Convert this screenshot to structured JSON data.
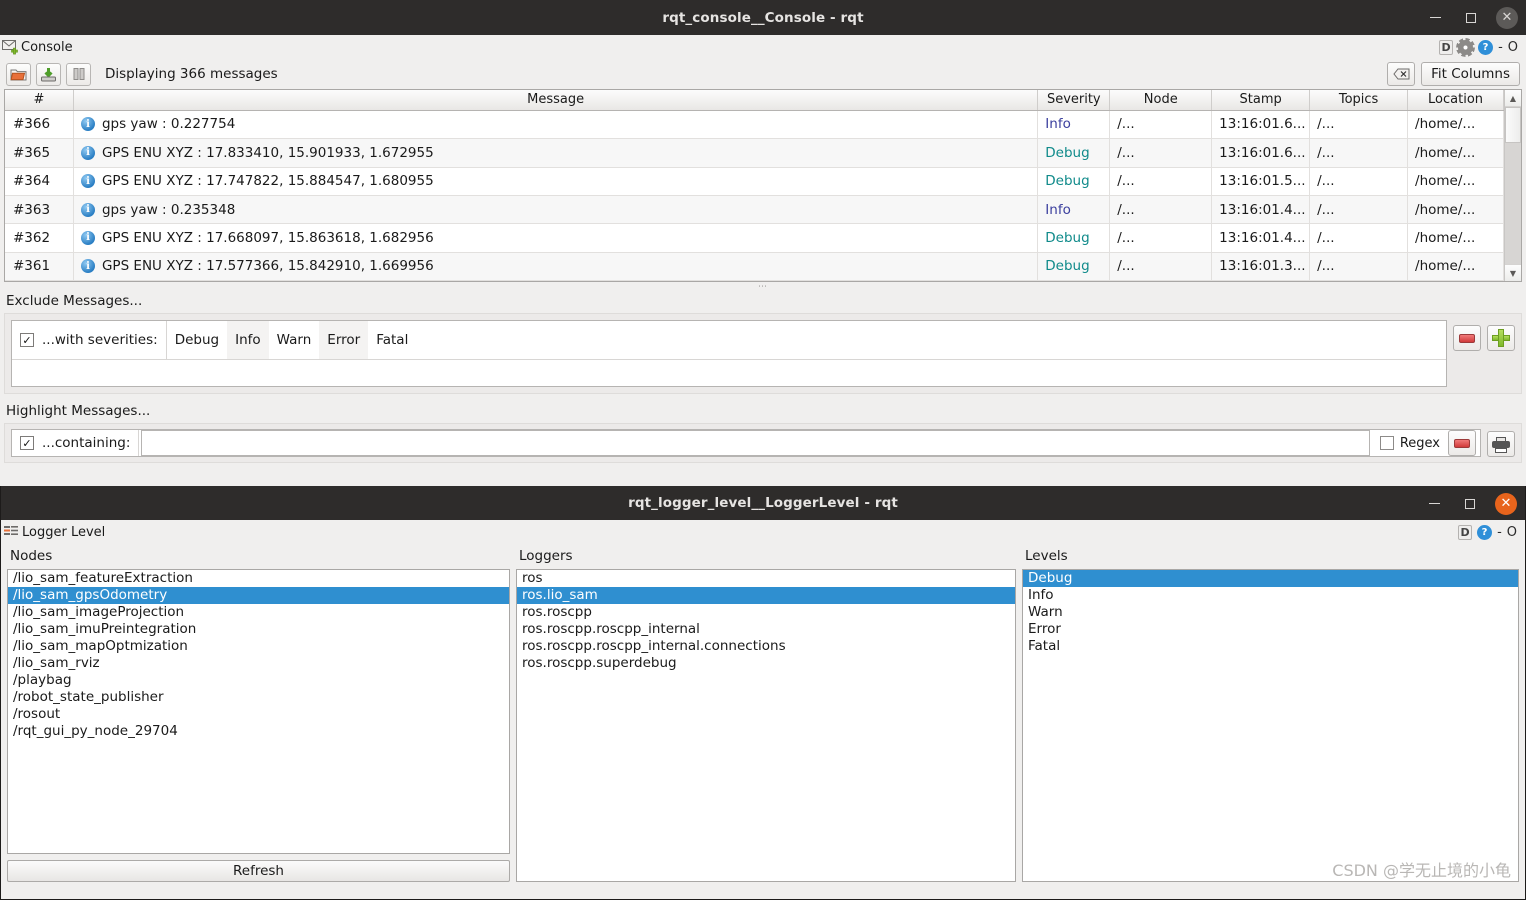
{
  "window1": {
    "title": "rqt_console__Console - rqt",
    "controls": {
      "minimize": "—",
      "maximize": "□",
      "close": "✕"
    },
    "dock": {
      "title": "Console",
      "icon": "envelope-plus-icon",
      "badges": [
        "D",
        "gear",
        "?"
      ],
      "minimize": "-",
      "float": "O"
    },
    "toolbar": {
      "open_label": "open-folder-icon",
      "save_label": "save-disk-icon",
      "pause_label": "pause-icon",
      "status": "Displaying 366 messages",
      "clear_label": "clear-icon",
      "fit_columns": "Fit Columns"
    },
    "table": {
      "columns": [
        "#",
        "Message",
        "Severity",
        "Node",
        "Stamp",
        "Topics",
        "Location"
      ],
      "rows": [
        {
          "num": "#366",
          "message": "gps yaw : 0.227754",
          "severity": "Info",
          "node": "/...",
          "stamp": "13:16:01.6...",
          "topics": "/...",
          "location": "/home/..."
        },
        {
          "num": "#365",
          "message": "GPS ENU XYZ : 17.833410, 15.901933, 1.672955",
          "severity": "Debug",
          "node": "/...",
          "stamp": "13:16:01.6...",
          "topics": "/...",
          "location": "/home/..."
        },
        {
          "num": "#364",
          "message": "GPS ENU XYZ : 17.747822, 15.884547, 1.680955",
          "severity": "Debug",
          "node": "/...",
          "stamp": "13:16:01.5...",
          "topics": "/...",
          "location": "/home/..."
        },
        {
          "num": "#363",
          "message": "gps yaw : 0.235348",
          "severity": "Info",
          "node": "/...",
          "stamp": "13:16:01.4...",
          "topics": "/...",
          "location": "/home/..."
        },
        {
          "num": "#362",
          "message": "GPS ENU XYZ : 17.668097, 15.863618, 1.682956",
          "severity": "Debug",
          "node": "/...",
          "stamp": "13:16:01.4...",
          "topics": "/...",
          "location": "/home/..."
        },
        {
          "num": "#361",
          "message": "GPS ENU XYZ : 17.577366, 15.842910, 1.669956",
          "severity": "Debug",
          "node": "/...",
          "stamp": "13:16:01.3...",
          "topics": "/...",
          "location": "/home/..."
        }
      ]
    },
    "exclude": {
      "heading": "Exclude Messages...",
      "checkbox_checked": "✓",
      "label": "...with severities:",
      "severities": [
        "Debug",
        "Info",
        "Warn",
        "Error",
        "Fatal"
      ],
      "remove_label": "remove-filter-icon",
      "add_label": "add-filter-icon"
    },
    "highlight": {
      "heading": "Highlight Messages...",
      "checkbox_checked": "✓",
      "label": "...containing:",
      "input_value": "",
      "input_placeholder": "",
      "regex_label": "Regex",
      "remove_label": "remove-filter-icon",
      "print_label": "print-icon"
    }
  },
  "window2": {
    "title": "rqt_logger_level__LoggerLevel - rqt",
    "controls": {
      "minimize": "—",
      "maximize": "□",
      "close": "✕"
    },
    "dock": {
      "title": "Logger Level",
      "badges": [
        "D",
        "?"
      ],
      "minimize": "-",
      "float": "O"
    },
    "nodes": {
      "label": "Nodes",
      "items": [
        "/lio_sam_featureExtraction",
        "/lio_sam_gpsOdometry",
        "/lio_sam_imageProjection",
        "/lio_sam_imuPreintegration",
        "/lio_sam_mapOptmization",
        "/lio_sam_rviz",
        "/playbag",
        "/robot_state_publisher",
        "/rosout",
        "/rqt_gui_py_node_29704"
      ],
      "selected_index": 1,
      "refresh_label": "Refresh"
    },
    "loggers": {
      "label": "Loggers",
      "items": [
        "ros",
        "ros.lio_sam",
        "ros.roscpp",
        "ros.roscpp.roscpp_internal",
        "ros.roscpp.roscpp_internal.connections",
        "ros.roscpp.superdebug"
      ],
      "selected_index": 1
    },
    "levels": {
      "label": "Levels",
      "items": [
        "Debug",
        "Info",
        "Warn",
        "Error",
        "Fatal"
      ],
      "selected_index": 0
    },
    "watermark": "CSDN @学无止境的小龟"
  },
  "colors": {
    "titlebar": "#2e2c2b",
    "selection": "#2f8fd0",
    "close_active": "#e8641c",
    "info": "#3b3f9e",
    "debug": "#0f8a8a"
  }
}
